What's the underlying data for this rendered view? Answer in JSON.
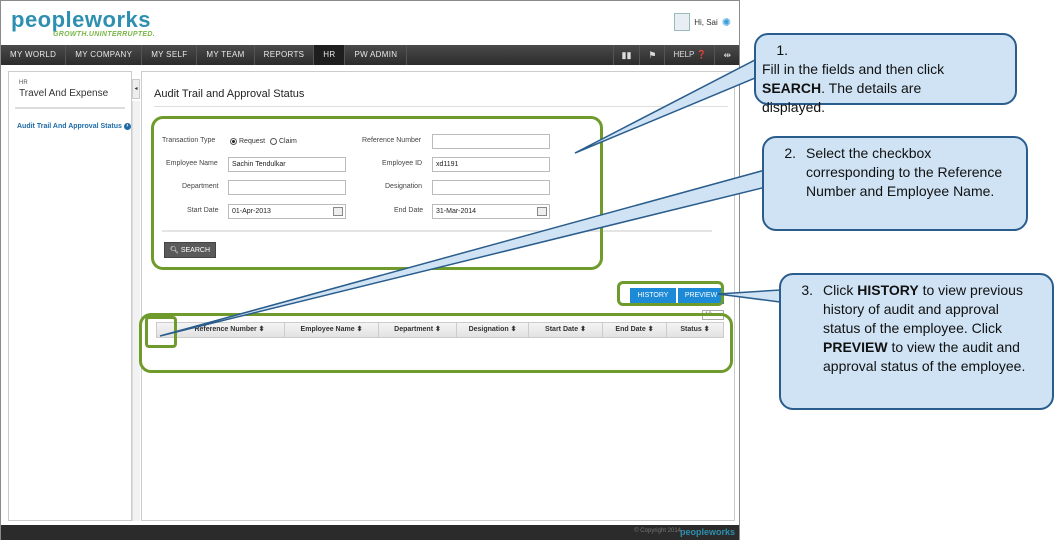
{
  "header": {
    "logo_text": "peopleworks",
    "tagline": "GROWTH.UNINTERRUPTED.",
    "greeting": "Hi, Sai"
  },
  "nav": {
    "items": [
      "MY WORLD",
      "MY COMPANY",
      "MY SELF",
      "MY TEAM",
      "REPORTS",
      "HR",
      "PW ADMIN"
    ],
    "active": "HR",
    "help_label": "HELP"
  },
  "sidebar": {
    "module": "HR",
    "title": "Travel And Expense",
    "link": "Audit Trail And Approval Status"
  },
  "page": {
    "title": "Audit Trail and Approval Status"
  },
  "form": {
    "transaction_type_label": "Transaction Type",
    "radio_request": "Request",
    "radio_claim": "Claim",
    "selected_type": "Request",
    "reference_number_label": "Reference Number",
    "reference_number_value": "",
    "employee_name_label": "Employee Name",
    "employee_name_value": "Sachin Tendulkar",
    "employee_id_label": "Employee ID",
    "employee_id_value": "xd1191",
    "department_label": "Department",
    "department_value": "",
    "designation_label": "Designation",
    "designation_value": "",
    "start_date_label": "Start Date",
    "start_date_value": "01-Apr-2013",
    "end_date_label": "End Date",
    "end_date_value": "31-Mar-2014",
    "search_label": "SEARCH"
  },
  "grid": {
    "history_label": "HISTORY",
    "preview_label": "PREVIEW",
    "page_size": "10",
    "columns": [
      "Reference Number",
      "Employee Name",
      "Department",
      "Designation",
      "Start Date",
      "End Date",
      "Status"
    ]
  },
  "footer": {
    "copyright": "© Copyright 2014",
    "logo_text": "peopleworks"
  },
  "callouts": [
    {
      "num": "1.",
      "text_before": "Fill in the fields and then click ",
      "bold": "SEARCH",
      "text_after": ". The details are displayed."
    },
    {
      "num": "2.",
      "text": "Select the checkbox corresponding to the Reference Number and Employee Name."
    },
    {
      "num": "3.",
      "text_a": "Click ",
      "bold_a": "HISTORY",
      "text_b": " to view previous history of audit and approval status of the employee. Click ",
      "bold_b": "PREVIEW",
      "text_c": " to view the audit and approval status of the employee."
    }
  ],
  "colors": {
    "accent_blue": "#1c8ad6",
    "highlight_green": "#6f9a2c",
    "callout_fill": "#cfe3f4",
    "callout_border": "#2a5d8c"
  }
}
